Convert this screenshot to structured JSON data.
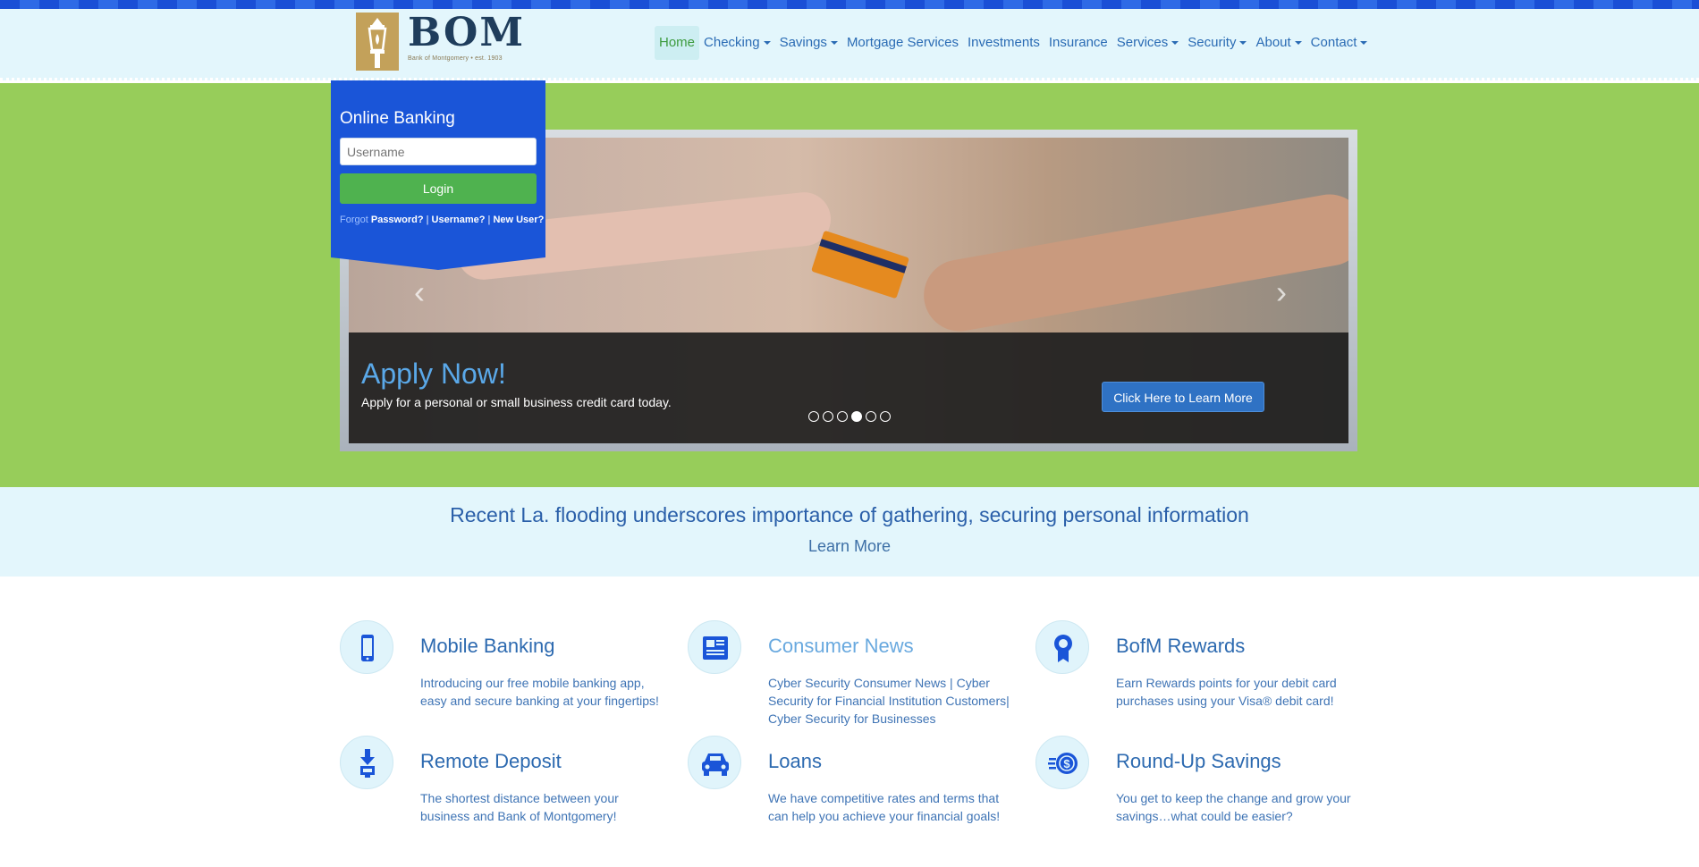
{
  "brand": {
    "logo_text": "BOM",
    "logo_subtext": "Bank of Montgomery  •  est. 1903"
  },
  "nav": {
    "items": [
      {
        "label": "Home",
        "dropdown": false,
        "active": true
      },
      {
        "label": "Checking",
        "dropdown": true
      },
      {
        "label": "Savings",
        "dropdown": true
      },
      {
        "label": "Mortgage Services",
        "dropdown": false
      },
      {
        "label": "Investments",
        "dropdown": false
      },
      {
        "label": "Insurance",
        "dropdown": false
      },
      {
        "label": "Services",
        "dropdown": true
      },
      {
        "label": "Security",
        "dropdown": true
      },
      {
        "label": "About",
        "dropdown": true
      },
      {
        "label": "Contact",
        "dropdown": true
      }
    ]
  },
  "online_banking": {
    "title": "Online Banking",
    "username_placeholder": "Username",
    "login_label": "Login",
    "forgot_label": "Forgot",
    "password_link": "Password?",
    "username_link": "Username?",
    "new_user_link": "New User?",
    "separator": " | "
  },
  "slider": {
    "title": "Apply Now!",
    "text": "Apply for a personal or small business credit card today.",
    "cta_label": "Click Here to Learn More",
    "dots_count": 6,
    "active_dot": 3,
    "prev_icon": "chevron-left-icon",
    "next_icon": "chevron-right-icon"
  },
  "news": {
    "headline": "Recent La. flooding underscores importance of gathering, securing personal information",
    "link_label": "Learn More"
  },
  "features": [
    {
      "icon": "mobile-phone-icon",
      "title": "Mobile Banking",
      "text": "Introducing our free mobile banking app, easy and secure banking at your fingertips!"
    },
    {
      "icon": "newspaper-icon",
      "title": "Consumer News",
      "text": "Cyber Security Consumer News | Cyber Security for Financial Institution Customers| Cyber Security for Businesses"
    },
    {
      "icon": "award-ribbon-icon",
      "title": "BofM Rewards",
      "text": "Earn Rewards points for your debit card purchases using your Visa® debit card!"
    },
    {
      "icon": "deposit-download-icon",
      "title": "Remote Deposit",
      "text": "The shortest distance between your business and Bank of Montgomery!"
    },
    {
      "icon": "car-icon",
      "title": "Loans",
      "text": "We have competitive rates and terms that can help you achieve your financial goals!"
    },
    {
      "icon": "coins-dollar-icon",
      "title": "Round-Up Savings",
      "text": "You get to keep the change and grow your savings…what could be easier?"
    }
  ],
  "colors": {
    "hero_green": "#97cd5a",
    "panel_blue": "#1a55d8",
    "login_green": "#4fb24f",
    "link_blue": "#2a6bb4",
    "header_bg": "#e3f6fc"
  }
}
